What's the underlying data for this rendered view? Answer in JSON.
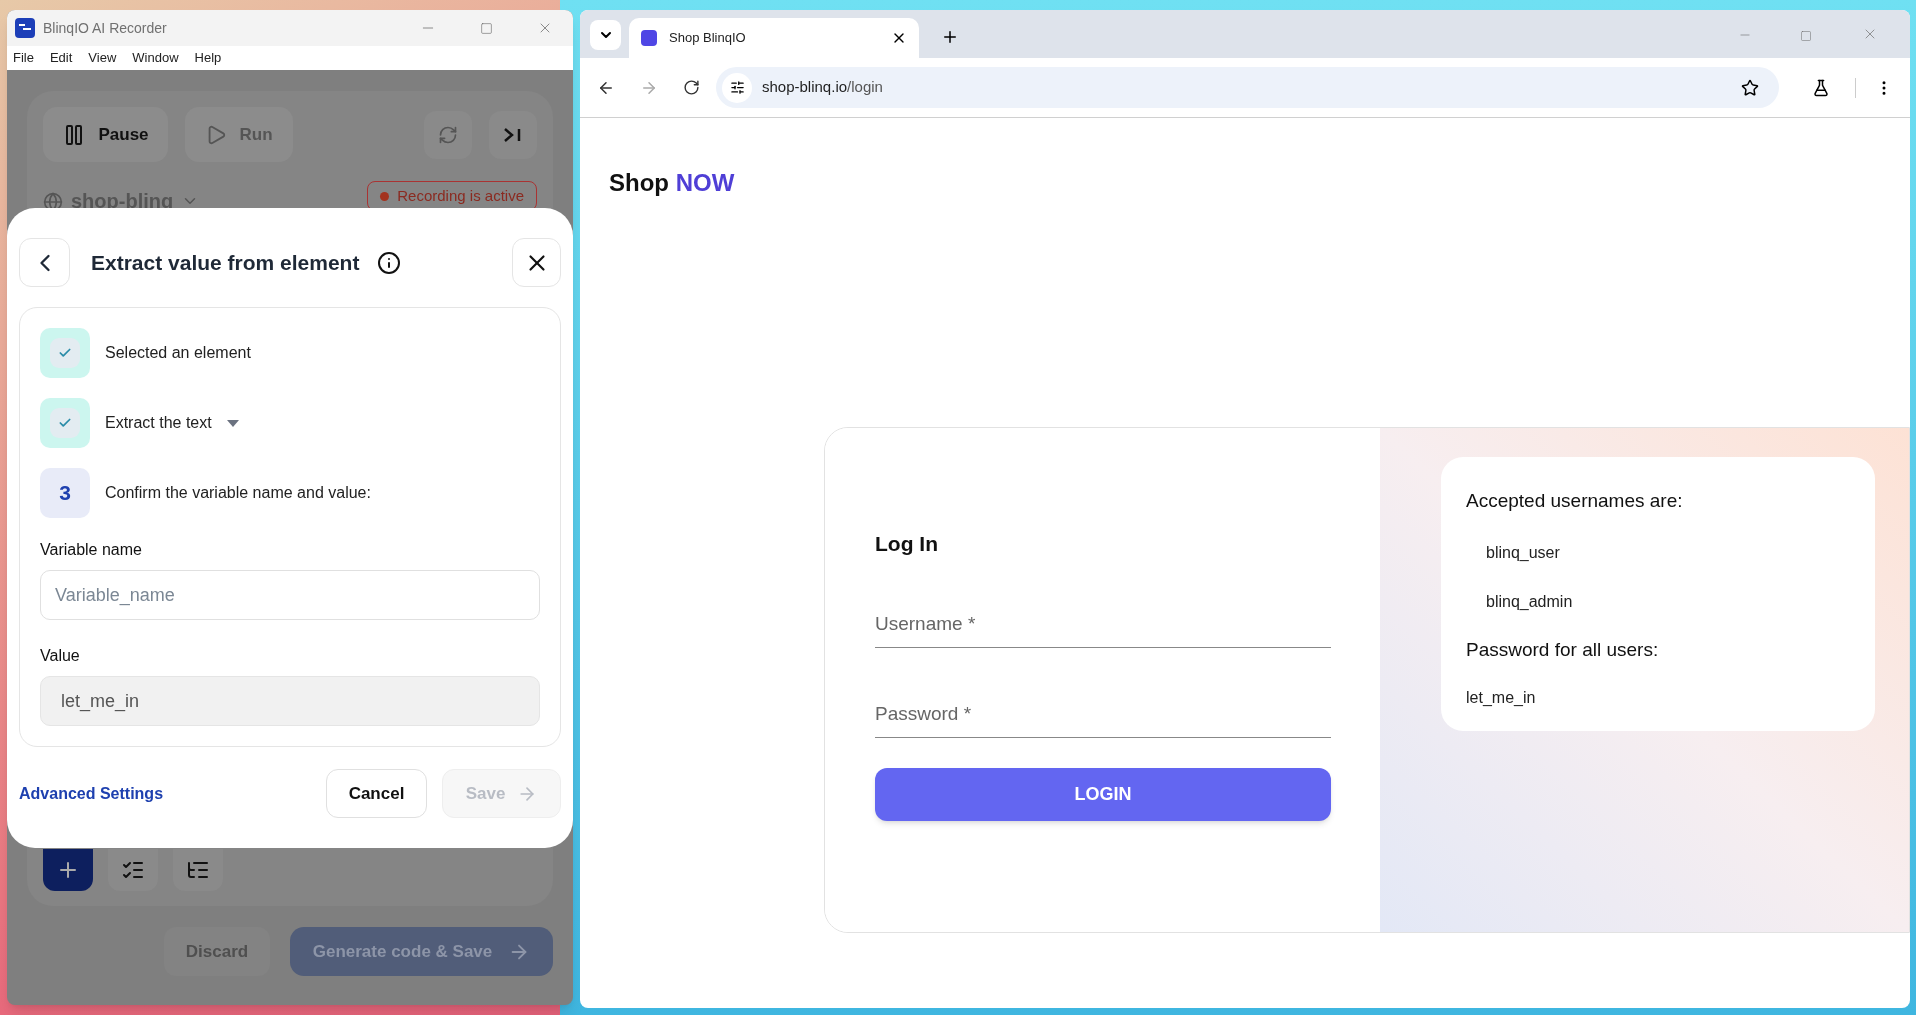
{
  "recorder": {
    "title": "BlinqIO AI Recorder",
    "menu": [
      "File",
      "Edit",
      "View",
      "Window",
      "Help"
    ],
    "pause": "Pause",
    "run": "Run",
    "run_disabled": true,
    "site": "shop-blinq",
    "recording_badge": "Recording is active",
    "dialog": {
      "title": "Extract value from element",
      "steps": [
        {
          "kind": "done",
          "label": "Selected an element",
          "dropdown": false
        },
        {
          "kind": "done",
          "label": "Extract the text",
          "dropdown": true
        },
        {
          "kind": "number",
          "number": "3",
          "label": "Confirm the variable name and value:",
          "dropdown": false
        }
      ],
      "variable_label": "Variable name",
      "variable_placeholder": "Variable_name",
      "value_label": "Value",
      "value": "let_me_in",
      "advanced": "Advanced Settings",
      "cancel": "Cancel",
      "save": "Save",
      "save_disabled": true
    },
    "discard": "Discard",
    "generate": "Generate code & Save"
  },
  "browser": {
    "tab": {
      "title": "Shop BlinqIO",
      "selected": true
    },
    "forward_disabled": true,
    "url_host": "shop-blinq.io",
    "url_path": "/login",
    "page": {
      "brand": "Shop",
      "brand_accent": "NOW",
      "login": {
        "title": "Log In",
        "fields": [
          {
            "placeholder": "Username *"
          },
          {
            "placeholder": "Password *"
          }
        ],
        "button": "LOGIN"
      },
      "info": {
        "usernames_title": "Accepted usernames are:",
        "usernames": [
          "blinq_user",
          "blinq_admin"
        ],
        "password_title": "Password for all users:",
        "password": "let_me_in"
      }
    }
  }
}
